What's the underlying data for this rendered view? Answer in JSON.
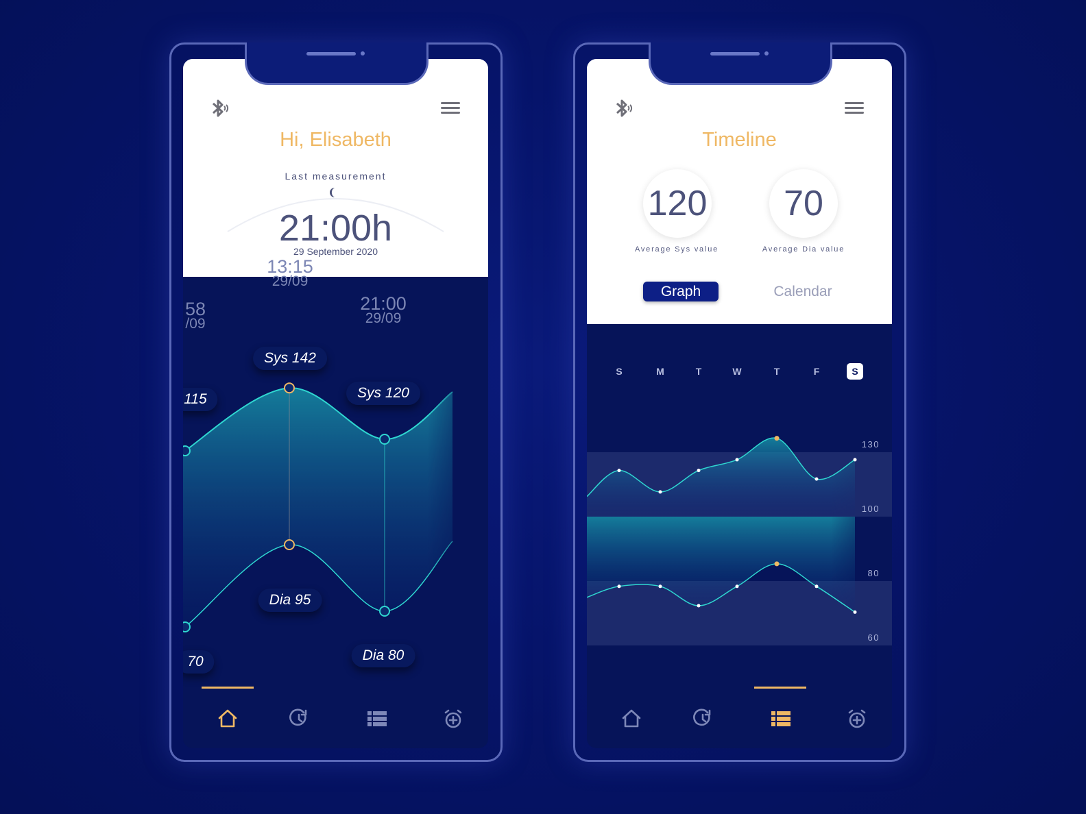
{
  "colors": {
    "accent": "#efb864",
    "teal": "#2fd6d0",
    "background": "#061459"
  },
  "home": {
    "greeting": "Hi, Elisabeth",
    "last_label": "Last measurement",
    "time": "21:00h",
    "date": "29 September 2020",
    "icons": {
      "left": "bluetooth-icon",
      "right": "menu-icon",
      "time": "moon-icon"
    },
    "readings": [
      {
        "time": "58",
        "date": "/09",
        "sys": 115,
        "dia": 70,
        "sys_label": "115",
        "dia_label": "70"
      },
      {
        "time": "13:15",
        "date": "29/09",
        "sys": 142,
        "dia": 95,
        "sys_label": "Sys 142",
        "dia_label": "Dia 95"
      },
      {
        "time": "21:00",
        "date": "29/09",
        "sys": 120,
        "dia": 80,
        "sys_label": "Sys 120",
        "dia_label": "Dia 80"
      }
    ],
    "nav": [
      {
        "icon": "home-icon",
        "active": true
      },
      {
        "icon": "history-icon"
      },
      {
        "icon": "list-icon"
      },
      {
        "icon": "alarm-add-icon"
      }
    ]
  },
  "timeline": {
    "title": "Timeline",
    "avg_sys": "120",
    "avg_sys_label": "Average  Sys value",
    "avg_dia": "70",
    "avg_dia_label": "Average  Dia value",
    "tabs": [
      {
        "label": "Graph",
        "active": true
      },
      {
        "label": "Calendar"
      }
    ],
    "nav": [
      {
        "icon": "home-icon"
      },
      {
        "icon": "history-icon"
      },
      {
        "icon": "list-icon",
        "active": true
      },
      {
        "icon": "alarm-add-icon"
      }
    ]
  },
  "chart_data": {
    "type": "area",
    "categories": [
      "S",
      "M",
      "T",
      "W",
      "T",
      "F",
      "S"
    ],
    "selected_day": "S",
    "y_ticks_sys": [
      "130",
      "100"
    ],
    "y_ticks_dia": [
      "80",
      "60"
    ],
    "sys_range": [
      100,
      130
    ],
    "dia_range": [
      60,
      80
    ],
    "series": [
      {
        "values": [
          118,
          108,
          118,
          123,
          133,
          114,
          123
        ],
        "peak_index": 4
      },
      {
        "values": [
          76,
          76,
          70,
          76,
          83,
          76,
          68
        ],
        "peak_index": 4
      }
    ]
  }
}
